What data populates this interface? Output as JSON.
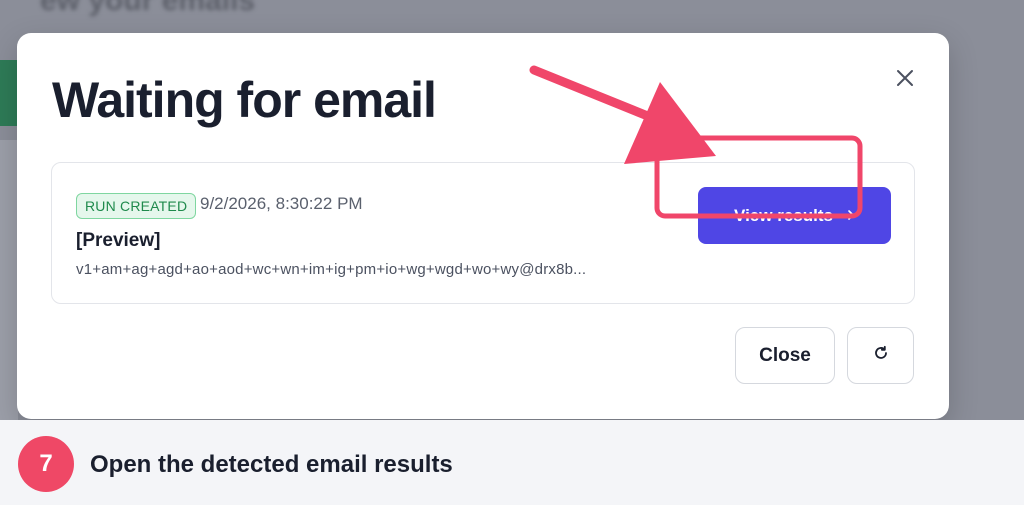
{
  "background": {
    "heading": "ew your emails"
  },
  "modal": {
    "title": "Waiting for email",
    "close_icon": "close-icon",
    "run": {
      "status_badge": "RUN CREATED",
      "timestamp": "9/2/2026, 8:30:22 PM",
      "name": "[Preview]",
      "email": "v1+am+ag+agd+ao+aod+wc+wn+im+ig+pm+io+wg+wgd+wo+wy@drx8b...",
      "view_button_label": "View results",
      "view_button_icon": "arrow-right-icon"
    },
    "close_button_label": "Close",
    "refresh_icon": "refresh-icon"
  },
  "annotation": {
    "color": "#f0466a",
    "step_number": "7",
    "step_text": "Open the detected email results"
  },
  "colors": {
    "primary": "#4f46e5",
    "badge_green": "#1f8a4c",
    "accent": "#ef4866"
  }
}
